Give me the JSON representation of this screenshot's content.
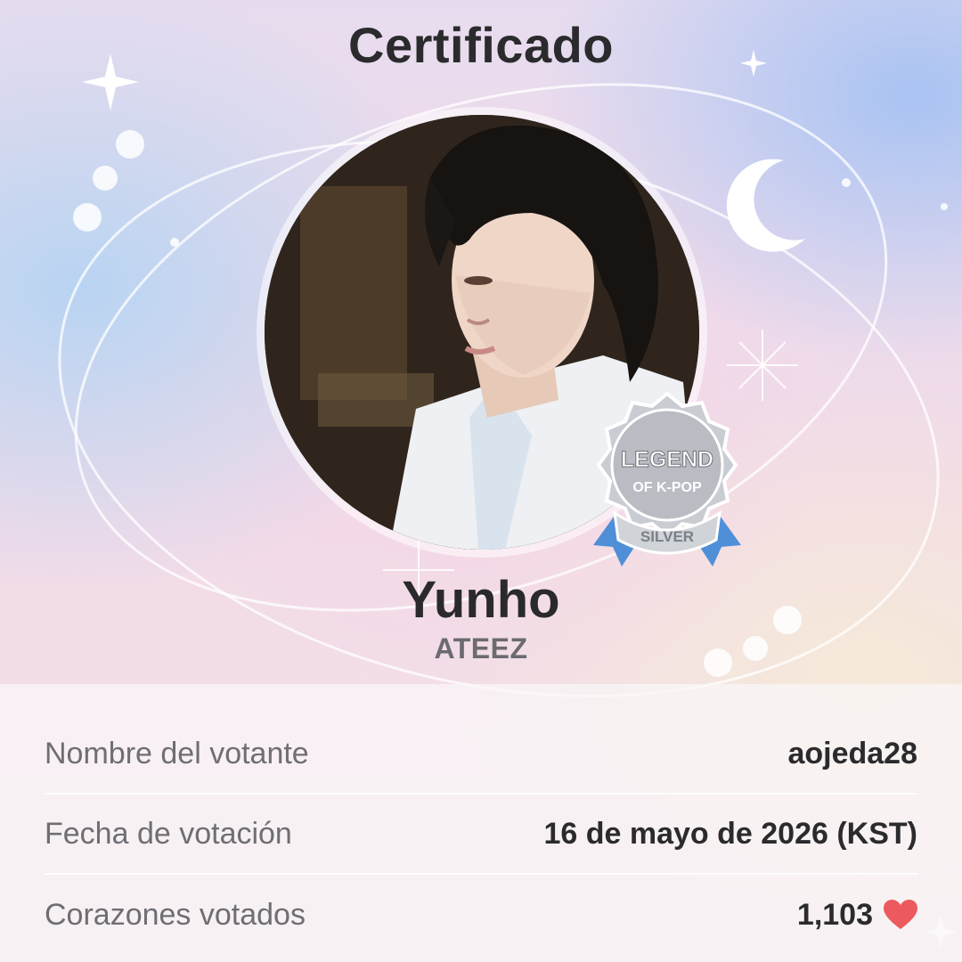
{
  "header": {
    "title": "Certificado"
  },
  "artist": {
    "name": "Yunho",
    "group": "ATEEZ"
  },
  "badge": {
    "line1": "LEGEND",
    "line2": "OF K-POP",
    "tier": "SILVER"
  },
  "details": {
    "voter_label": "Nombre del votante",
    "voter_value": "aojeda28",
    "date_label": "Fecha de votación",
    "date_value": "16 de mayo de 2026 (KST)",
    "hearts_label": "Corazones votados",
    "hearts_value": "1,103"
  },
  "colors": {
    "heart": "#ec5a5f",
    "badge_silver": "#b9bcc2",
    "badge_ribbon": "#4f8fd8",
    "title_text": "#2b2b2d"
  },
  "icons": {
    "heart": "heart-icon",
    "moon": "moon-icon",
    "sparkle": "sparkle-icon"
  }
}
